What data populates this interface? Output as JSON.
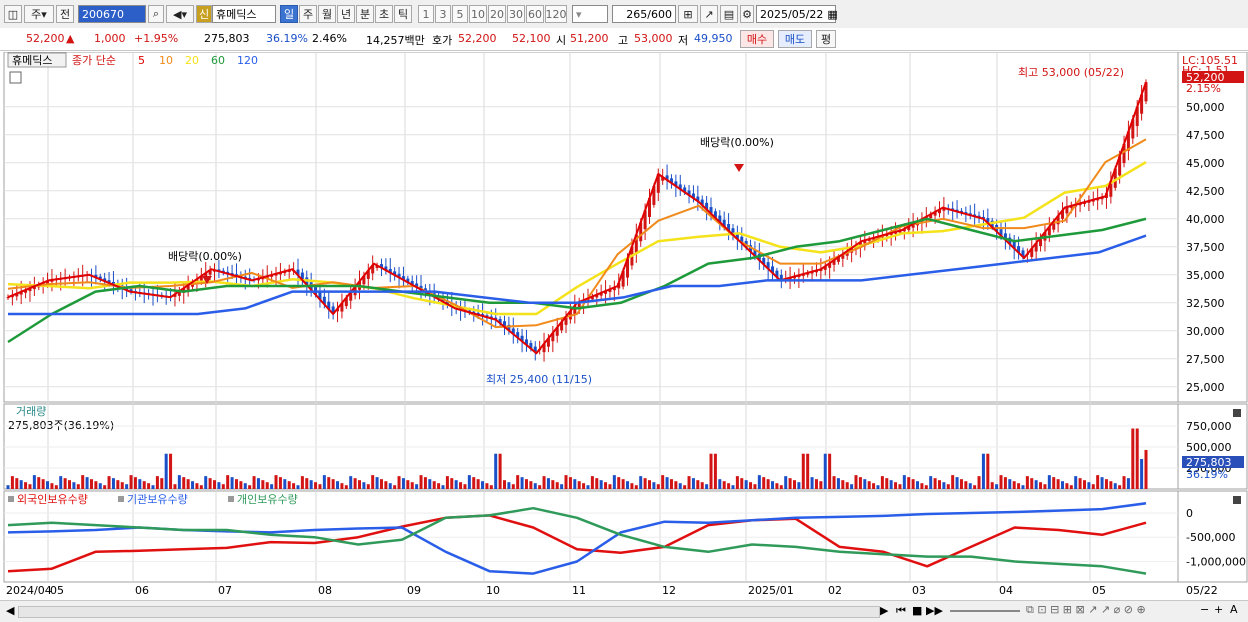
{
  "toolbar": {
    "period_select": "주",
    "prev_label": "전",
    "code": "200670",
    "credit_badge": "신",
    "name": "휴메딕스",
    "periods": [
      "일",
      "주",
      "월",
      "년",
      "분",
      "초",
      "틱"
    ],
    "active_period": "일",
    "intervals": [
      "1",
      "3",
      "5",
      "10",
      "20",
      "30",
      "60",
      "120"
    ],
    "count": "265",
    "count_total": "/600",
    "date": "2025/05/22"
  },
  "quote": {
    "price": "52,200",
    "arrow": "▲",
    "change": "1,000",
    "change_pct": "+1.95%",
    "volume": "275,803",
    "volume_ratio": "36.19%",
    "turnover": "2.46%",
    "amount": "14,257백만",
    "ask_label": "호가",
    "ask": "52,200",
    "bid": "52,100",
    "open_label": "시",
    "open": "51,200",
    "high_label": "고",
    "high": "53,000",
    "low_label": "저",
    "low": "49,950",
    "buy_label": "매수",
    "sell_label": "매도",
    "eval_label": "평"
  },
  "chart": {
    "price_legend": {
      "name": "휴메딕스",
      "item": "종가 단순",
      "ma": [
        "5",
        "10",
        "20",
        "60",
        "120"
      ]
    },
    "annotations": {
      "high": "최고 53,000 (05/22)",
      "low": "최저 25,400 (11/15)",
      "div1": "배당락(0.00%)",
      "div2": "배당락(0.00%)"
    },
    "lc": "LC:105.51",
    "hc": "HC: 1.51",
    "price_tag": "52,200",
    "pct_tag": "2.15%",
    "volume_title": "거래량",
    "volume_info": "275,803주(36.19%)",
    "volume_tag": "275,803",
    "volume_pct_tag": "36.19%",
    "holdings_legend": [
      "외국인보유수량",
      "기관보유수량",
      "개인보유수량"
    ],
    "date_cursor": "05/22",
    "colors": {
      "up": "#d21414",
      "down": "#1a4fc8",
      "ma5": "#e00000",
      "ma10": "#f08a1a",
      "ma20": "#f4e21a",
      "ma60": "#1e9a3a",
      "ma120": "#2a5ee8",
      "foreign": "#e01010",
      "institution": "#2a5ee8",
      "individual": "#2f9a5a"
    }
  },
  "chart_data": [
    {
      "type": "line",
      "title": "휴메딕스 종가 단순",
      "x": [
        "2024/04",
        "05",
        "06",
        "07",
        "08",
        "09",
        "10",
        "11",
        "12",
        "2025/01",
        "02",
        "03",
        "04",
        "05"
      ],
      "ylim": [
        24000,
        54000
      ],
      "yticks": [
        25000,
        27500,
        30000,
        32500,
        35000,
        37500,
        40000,
        42500,
        45000,
        47500,
        50000
      ],
      "series": [
        {
          "name": "5",
          "values": [
            33000,
            34500,
            35000,
            33500,
            33000,
            35500,
            34500,
            35500,
            31500,
            36000,
            34000,
            32000,
            31000,
            28000,
            32500,
            34000,
            44000,
            41500,
            38000,
            34500,
            35500,
            38000,
            39000,
            41000,
            40000,
            36500,
            41000,
            42000,
            52200
          ]
        },
        {
          "name": "60",
          "values": [
            29000,
            31500,
            33500,
            34000,
            33500,
            34000,
            34000,
            34000,
            34000,
            33500,
            33000,
            32500,
            32500,
            32000,
            32500,
            34000,
            36000,
            36500,
            37500,
            38000,
            39000,
            40000,
            39000,
            38000,
            38500,
            39000,
            40000
          ]
        },
        {
          "name": "120",
          "values": [
            31500,
            31500,
            31500,
            31500,
            31500,
            32000,
            33500,
            33500,
            33500,
            33500,
            33000,
            32500,
            32500,
            33000,
            34000,
            34000,
            34500,
            34500,
            34500,
            35000,
            35500,
            36000,
            36500,
            37000,
            38500
          ]
        }
      ]
    },
    {
      "type": "bar",
      "title": "거래량",
      "ylim": [
        0,
        750000
      ],
      "yticks": [
        250000,
        500000,
        750000
      ],
      "last": 275803
    },
    {
      "type": "line",
      "title": "보유수량",
      "yticks": [
        0,
        -500000,
        -1000000
      ],
      "series": [
        {
          "name": "외국인보유수량",
          "values": [
            -1200000,
            -1150000,
            -800000,
            -780000,
            -750000,
            -720000,
            -600000,
            -620000,
            -500000,
            -280000,
            -100000,
            -50000,
            -300000,
            -750000,
            -820000,
            -700000,
            -250000,
            -150000,
            -120000,
            -700000,
            -800000,
            -1100000,
            -700000,
            -300000,
            -350000,
            -450000,
            -200000
          ]
        },
        {
          "name": "기관보유수량",
          "values": [
            -400000,
            -380000,
            -350000,
            -300000,
            -350000,
            -380000,
            -400000,
            -350000,
            -320000,
            -300000,
            -800000,
            -1200000,
            -1250000,
            -1000000,
            -400000,
            -180000,
            -200000,
            -150000,
            -100000,
            -80000,
            -60000,
            -20000,
            0,
            20000,
            50000,
            80000,
            200000
          ]
        },
        {
          "name": "개인보유수량",
          "values": [
            -250000,
            -200000,
            -250000,
            -300000,
            -350000,
            -350000,
            -450000,
            -500000,
            -650000,
            -550000,
            -100000,
            -50000,
            100000,
            -100000,
            -450000,
            -700000,
            -800000,
            -650000,
            -700000,
            -800000,
            -850000,
            -900000,
            -900000,
            -1000000,
            -1050000,
            -1100000,
            -1250000
          ]
        }
      ]
    }
  ],
  "status": {
    "nav": [
      "▶",
      "⏮",
      "◀◀",
      "■",
      "▶▶"
    ],
    "zoom": [
      "−",
      "+",
      "A"
    ]
  }
}
